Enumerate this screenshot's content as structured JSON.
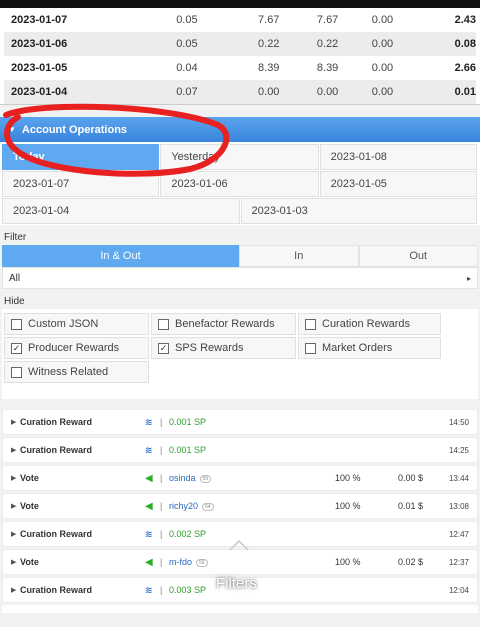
{
  "summary": {
    "rows": [
      {
        "date": "2023-01-07",
        "c1": "0.05",
        "c2": "7.67",
        "c3": "7.67",
        "c4": "0.00",
        "c5": "2.43"
      },
      {
        "date": "2023-01-06",
        "c1": "0.05",
        "c2": "0.22",
        "c3": "0.22",
        "c4": "0.00",
        "c5": "0.08"
      },
      {
        "date": "2023-01-05",
        "c1": "0.04",
        "c2": "8.39",
        "c3": "8.39",
        "c4": "0.00",
        "c5": "2.66"
      },
      {
        "date": "2023-01-04",
        "c1": "0.07",
        "c2": "0.00",
        "c3": "0.00",
        "c4": "0.00",
        "c5": "0.01"
      }
    ]
  },
  "account_operations": {
    "title": "Account Operations",
    "periods": {
      "today": "Today",
      "yesterday": "Yesterday",
      "d0108": "2023-01-08",
      "d0107": "2023-01-07",
      "d0106": "2023-01-06",
      "d0105": "2023-01-05",
      "d0104": "2023-01-04",
      "d0103": "2023-01-03"
    }
  },
  "filter": {
    "label": "Filter",
    "tabs": {
      "in_out": "In & Out",
      "in": "In",
      "out": "Out"
    },
    "select_value": "All"
  },
  "hide": {
    "label": "Hide",
    "custom_json": "Custom JSON",
    "benefactor": "Benefactor Rewards",
    "curation": "Curation Rewards",
    "producer": "Producer Rewards",
    "sps": "SPS Rewards",
    "market": "Market Orders",
    "witness": "Witness Related",
    "checked_mark": "✓"
  },
  "operations": [
    {
      "type": "Curation Reward",
      "value": "0.001 SP",
      "time": "14:50"
    },
    {
      "type": "Curation Reward",
      "value": "0.001 SP",
      "time": "14:25"
    },
    {
      "type": "Vote",
      "user": "osinda",
      "rep": "59",
      "pct": "100 %",
      "usd": "0.00 $",
      "time": "13:44"
    },
    {
      "type": "Vote",
      "user": "richy20",
      "rep": "64",
      "pct": "100 %",
      "usd": "0.01 $",
      "time": "13:08"
    },
    {
      "type": "Curation Reward",
      "value": "0.002 SP",
      "time": "12:47"
    },
    {
      "type": "Vote",
      "user": "m-fdo",
      "rep": "59",
      "pct": "100 %",
      "usd": "0.02 $",
      "time": "12:37"
    },
    {
      "type": "Curation Reward",
      "value": "0.003 SP",
      "time": "12:04"
    }
  ],
  "floating": {
    "filters_label": "Filters"
  },
  "icons": {
    "caret": "caret-right-icon",
    "steem": "steem-logo-icon",
    "vote": "upvote-arrow-icon",
    "chevron": "chevron-up-icon"
  },
  "colors": {
    "accent": "#5fa9f1",
    "section_bar": "#3a85dc",
    "sp_value": "#2ea02e",
    "username": "#2a6bbf",
    "annotation": "#e82020"
  }
}
